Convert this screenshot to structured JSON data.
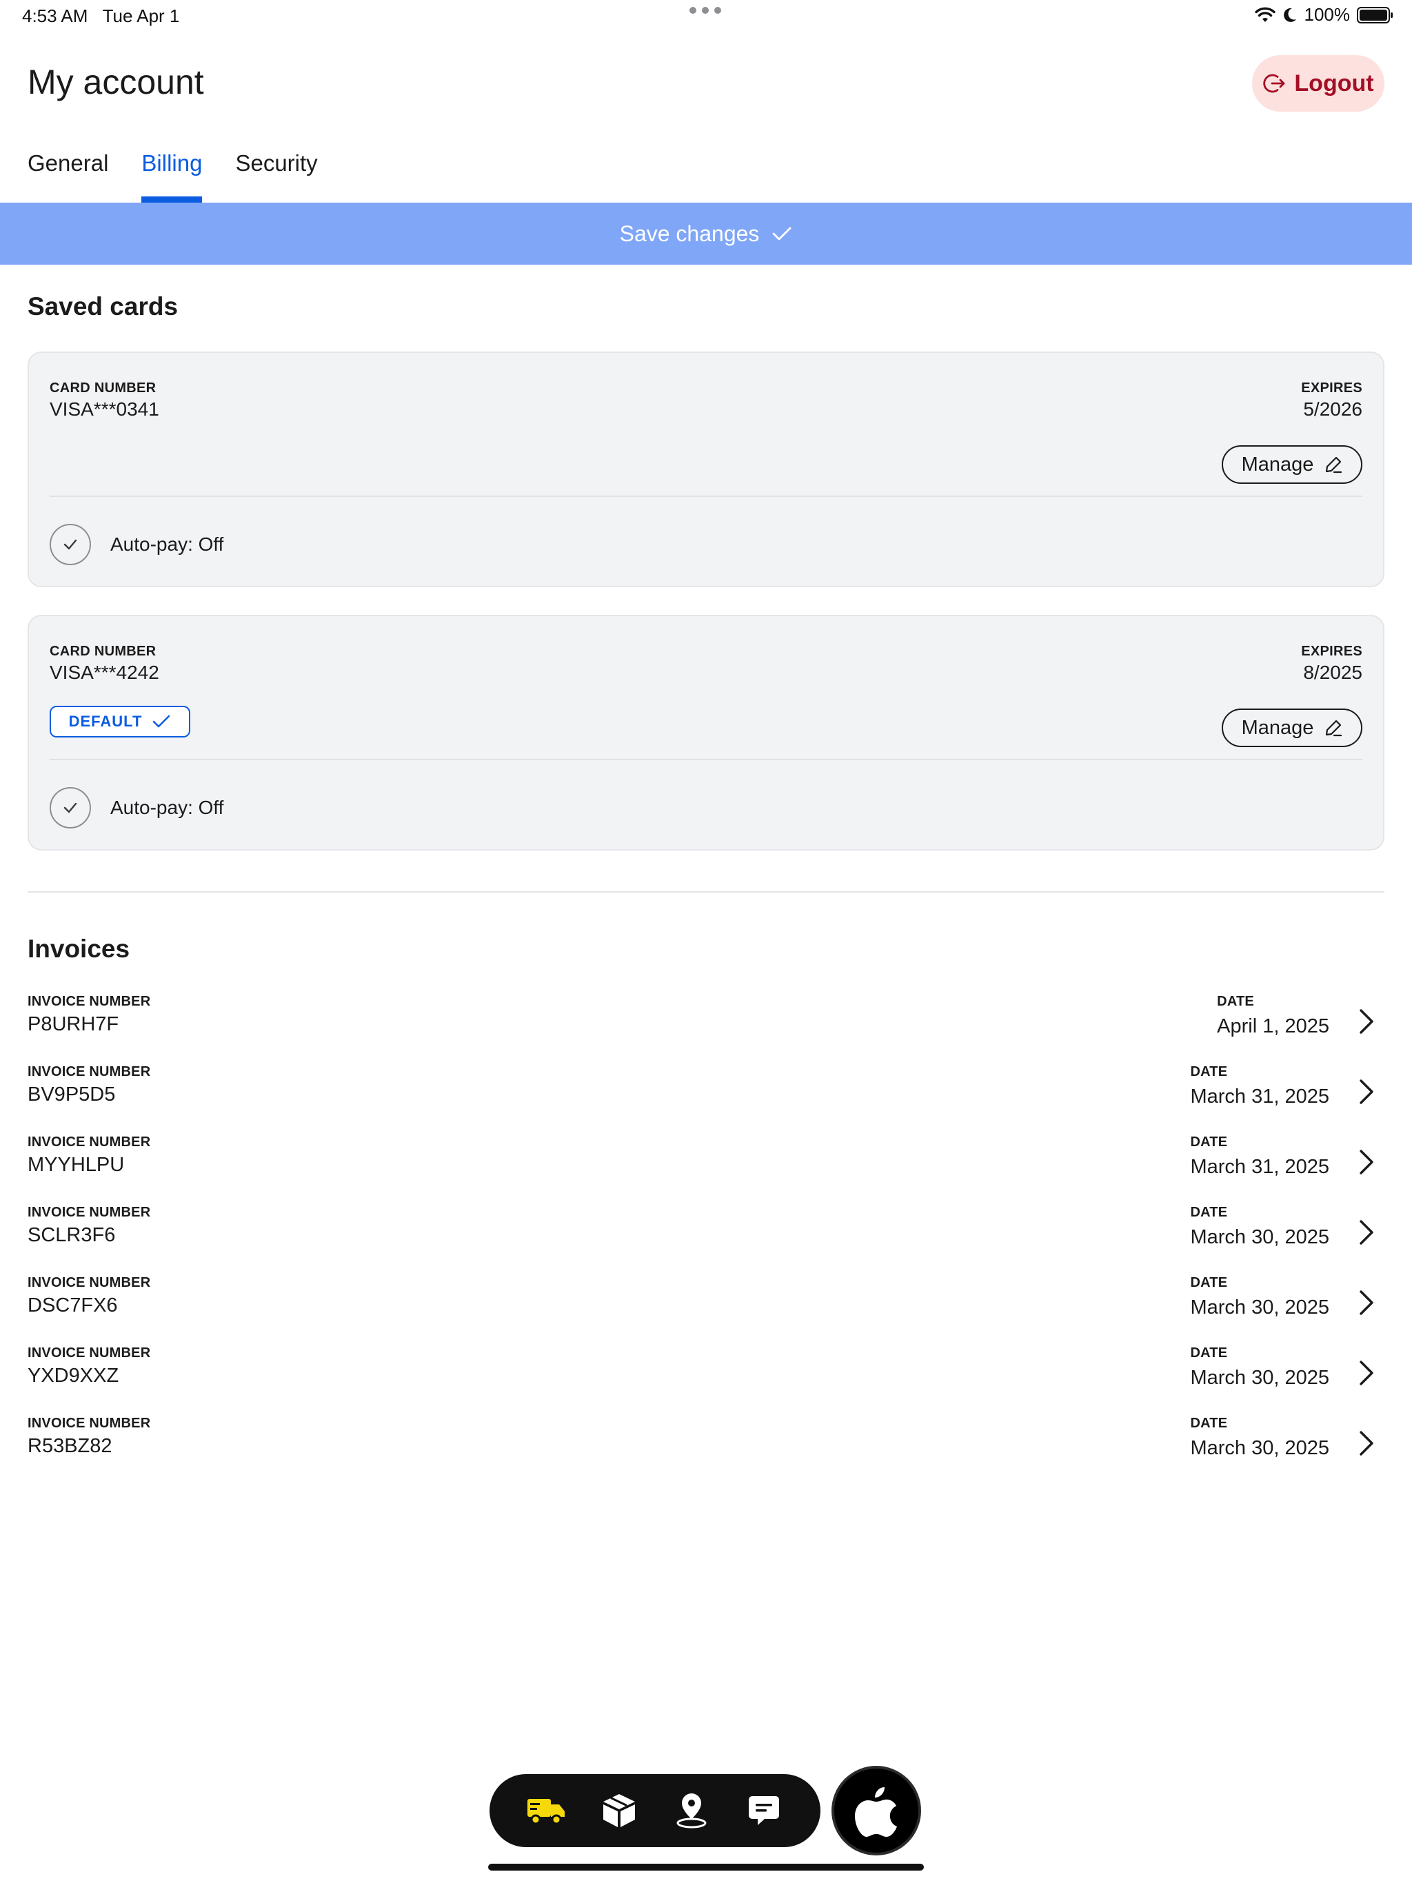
{
  "status_bar": {
    "time": "4:53 AM",
    "date": "Tue Apr 1",
    "battery": "100%",
    "battery_level": 1.0
  },
  "header": {
    "title": "My account",
    "logout_label": "Logout"
  },
  "tabs": [
    {
      "label": "General",
      "active": false
    },
    {
      "label": "Billing",
      "active": true
    },
    {
      "label": "Security",
      "active": false
    }
  ],
  "save_bar": {
    "label": "Save changes"
  },
  "saved_cards": {
    "title": "Saved cards",
    "cards": [
      {
        "number_label": "CARD NUMBER",
        "number": "VISA***0341",
        "expires_label": "EXPIRES",
        "expires": "5/2026",
        "manage_label": "Manage",
        "autopay": "Auto-pay: Off",
        "is_default": false
      },
      {
        "number_label": "CARD NUMBER",
        "number": "VISA***4242",
        "expires_label": "EXPIRES",
        "expires": "8/2025",
        "manage_label": "Manage",
        "autopay": "Auto-pay: Off",
        "is_default": true,
        "default_label": "DEFAULT"
      }
    ]
  },
  "invoices": {
    "title": "Invoices",
    "number_label": "INVOICE NUMBER",
    "date_label": "DATE",
    "items": [
      {
        "number": "P8URH7F",
        "date": "April 1, 2025"
      },
      {
        "number": "BV9P5D5",
        "date": "March 31, 2025"
      },
      {
        "number": "MYYHLPU",
        "date": "March 31, 2025"
      },
      {
        "number": "SCLR3F6",
        "date": "March 30, 2025"
      },
      {
        "number": "DSC7FX6",
        "date": "March 30, 2025"
      },
      {
        "number": "YXD9XXZ",
        "date": "March 30, 2025"
      },
      {
        "number": "R53BZ82",
        "date": "March 30, 2025"
      }
    ]
  },
  "dock": {
    "items": [
      "truck-icon",
      "package-icon",
      "location-pin-icon",
      "message-icon"
    ],
    "active_color": "#f5d90a",
    "apple_button": "apple-icon"
  },
  "colors": {
    "accent": "#0b5ce0",
    "save_bar": "#7fa6f7",
    "logout_bg": "#fde1df",
    "logout_text": "#a30f25"
  }
}
